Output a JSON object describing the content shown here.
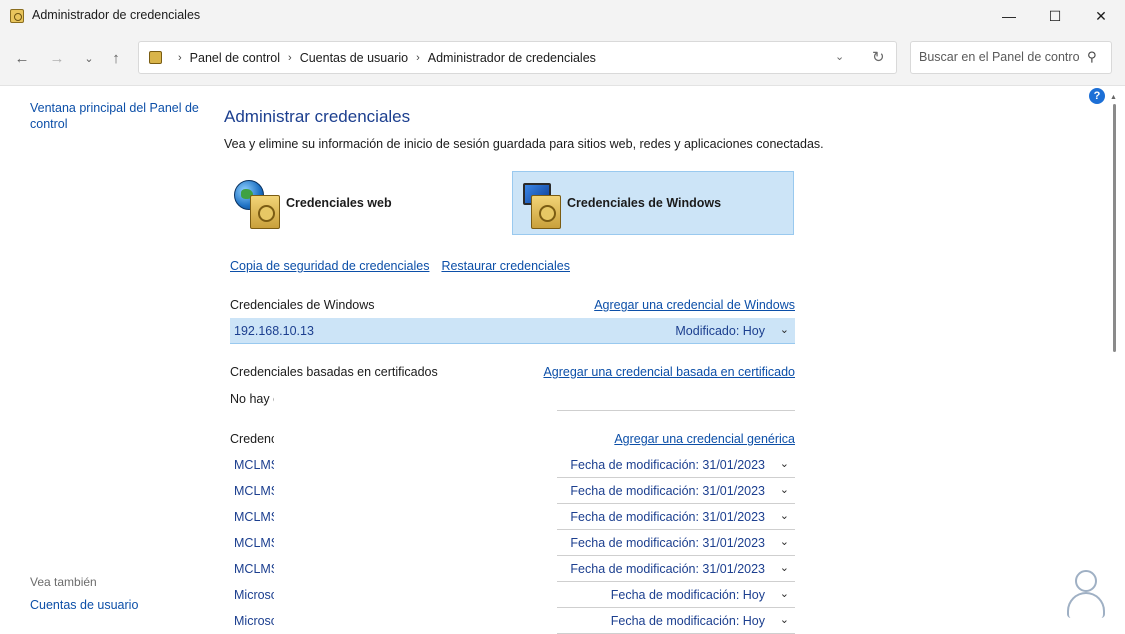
{
  "window": {
    "title": "Administrador de credenciales",
    "minimize_glyph": "—",
    "maximize_glyph": "☐",
    "close_glyph": "✕"
  },
  "nav": {
    "back_glyph": "←",
    "forward_glyph": "→",
    "recent_glyph": "⌄",
    "up_glyph": "↑",
    "breadcrumb": [
      "Panel de control",
      "Cuentas de usuario",
      "Administrador de credenciales"
    ],
    "breadcrumb_sep": "›",
    "dropdown_glyph": "⌄",
    "refresh_glyph": "↻",
    "search_placeholder": "Buscar en el Panel de control",
    "search_glyph": "⚲"
  },
  "sidebar": {
    "home_link": "Ventana principal del Panel de control",
    "see_also": "Vea también",
    "user_accounts_link": "Cuentas de usuario"
  },
  "main": {
    "heading": "Administrar credenciales",
    "description": "Vea y elimine su información de inicio de sesión guardada para sitios web, redes y aplicaciones conectadas.",
    "web_credentials": "Credenciales web",
    "windows_credentials": "Credenciales de Windows",
    "backup_link": "Copia de seguridad de credenciales",
    "restore_link": "Restaurar credenciales",
    "help_glyph": "?"
  },
  "windows_section": {
    "title": "Credenciales de Windows",
    "add_link": "Agregar una credencial de Windows",
    "entries": [
      {
        "address": "192.168.10.13",
        "meta": "Modificado:  Hoy"
      }
    ]
  },
  "certificate_section": {
    "title": "Credenciales basadas en certificados",
    "add_link": "Agregar una credencial basada en certificado",
    "empty_text": "No hay certificados."
  },
  "generic_section": {
    "title": "Credenciales genéricas",
    "add_link": "Agregar una credencial genérica",
    "entries": [
      {
        "address": "MCLMS",
        "meta": "Fecha de modificación:  31/01/2023"
      },
      {
        "address": "MCLMS",
        "meta": "Fecha de modificación:  31/01/2023"
      },
      {
        "address": "MCLMS",
        "meta": "Fecha de modificación:  31/01/2023"
      },
      {
        "address": "MCLMS",
        "meta": "Fecha de modificación:  31/01/2023"
      },
      {
        "address": "MCLMS",
        "meta": "Fecha de modificación:  31/01/2023"
      },
      {
        "address": "Microsoft",
        "meta": "Fecha de modificación:  Hoy"
      },
      {
        "address": "Microsoft",
        "meta": "Fecha de modificación:  Hoy"
      }
    ]
  },
  "chevron_glyph": "⌄"
}
